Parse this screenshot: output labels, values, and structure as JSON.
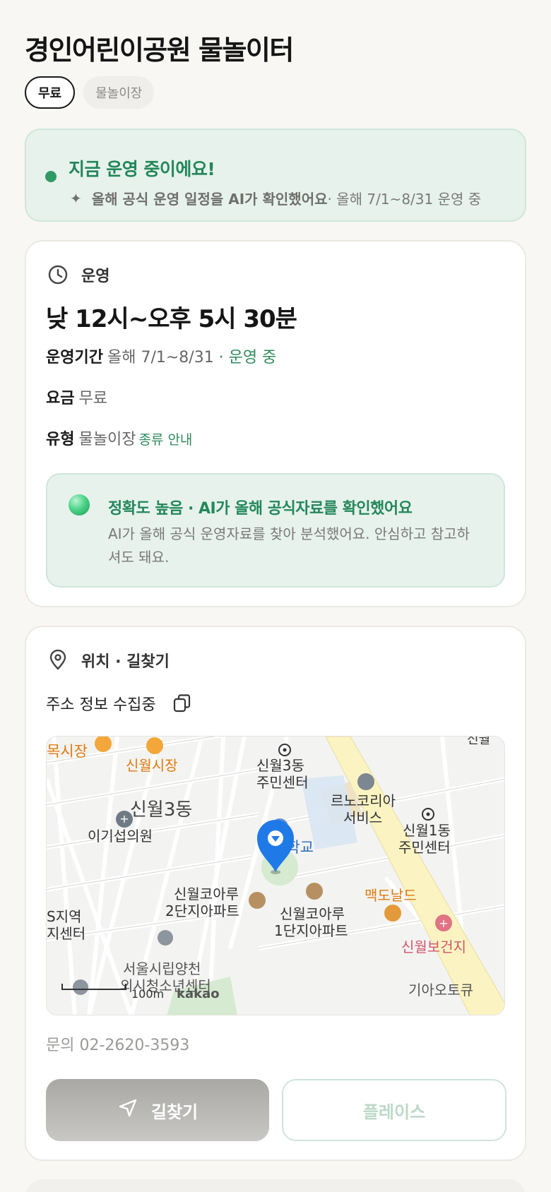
{
  "title": "경인어린이공원 물놀이터",
  "chips": {
    "active": "무료",
    "inactive": "물놀이장"
  },
  "status": {
    "title": "지금 운영 중이에요!",
    "sub_strong": "올해 공식 운영 일정을 AI가 확인했어요",
    "sub_rest": " · 올해 7/1~8/31 운영 중",
    "colors": {
      "accent": "#23875a",
      "background": "#e7f2ec"
    }
  },
  "operation": {
    "section_title": "운영",
    "hours": "낮 12시~오후 5시 30분",
    "period_label": "운영기간",
    "period_value": "올해 7/1~8/31",
    "period_status": " · 운영 중",
    "fee_label": "요금",
    "fee_value": "무료",
    "type_label": "유형",
    "type_value": "물놀이장",
    "type_link": "종류 안내",
    "ai_title": "정확도 높음 · AI가 올해 공식자료를 확인했어요",
    "ai_desc": "AI가 올해 공식 운영자료를 찾아 분석했어요. 안심하고 참고하셔도 돼요."
  },
  "location": {
    "section_title": "위치 · 길찾기",
    "address": "주소 정보 수집중",
    "map_labels": {
      "market1": "목시장",
      "market2": "신월시장",
      "dong3_center_a": "신월3동",
      "dong3_center_b": "주민센터",
      "renault_a": "르노코리아",
      "renault_b": "서비스",
      "dong3": "신월3동",
      "clinic": "이기섭의원",
      "dong1_a": "신월1동",
      "dong1_b": "주민센터",
      "school": "중학교",
      "apt2_a": "신월코아루",
      "apt2_b": "2단지아파트",
      "apt1_a": "신월코아루",
      "apt1_b": "1단지아파트",
      "mcd": "맥도날드",
      "health": "신월보건지",
      "region_a": "S지역",
      "region_b": "지센터",
      "youth_a": "서울시립양천",
      "youth_b": "외시청소년센터",
      "kia": "기아오토큐",
      "topright": "신월",
      "scale": "100m",
      "brand": "kakao"
    },
    "phone": "문의 02-2620-3593",
    "nav_button": "길찾기",
    "place_button": "플레이스"
  }
}
